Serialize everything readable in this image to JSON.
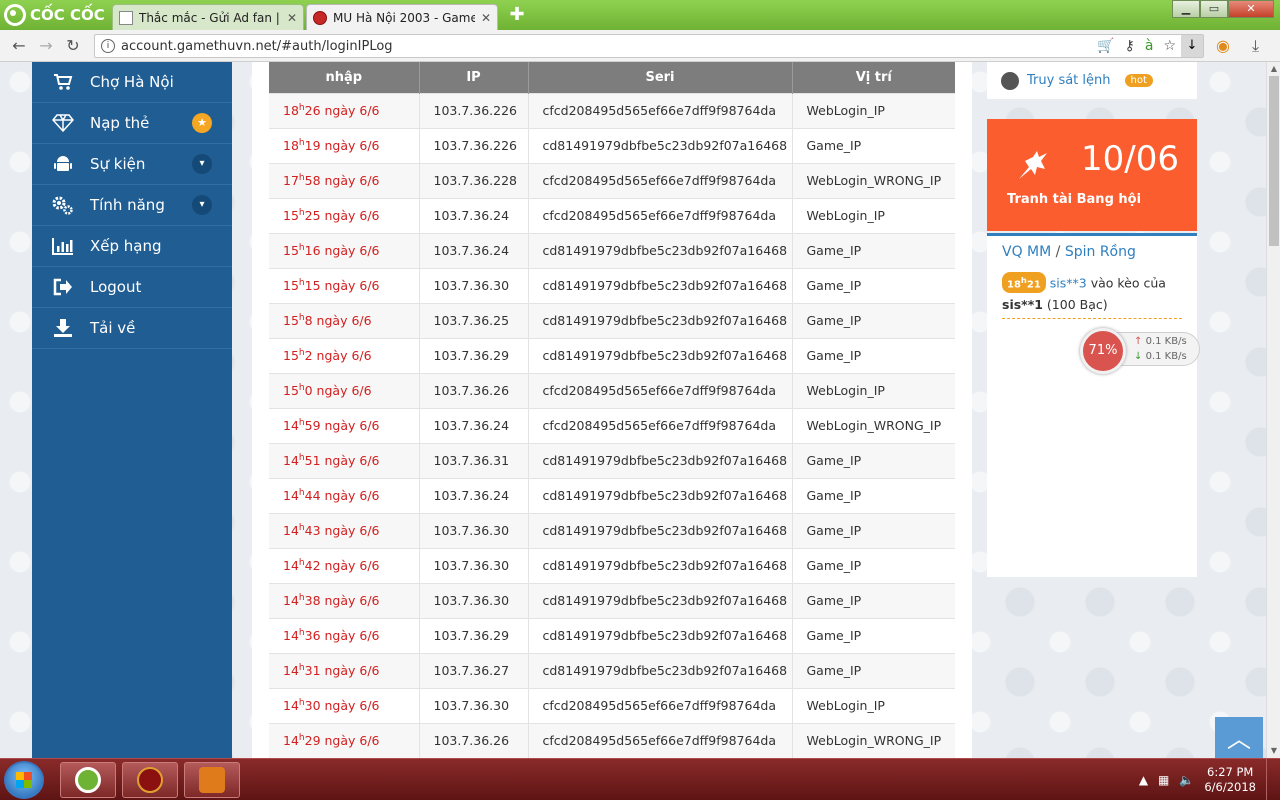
{
  "browser": {
    "brand": "CỐC CỐC",
    "tabs": [
      {
        "title": "Thắc mắc - Gửi Ad fan | Ga"
      },
      {
        "title": "MU Hà Nội 2003 - Gameth"
      }
    ],
    "url": "account.gamethuvn.net/#auth/loginIPLog"
  },
  "sidebar": {
    "items": [
      {
        "label": "Chợ Hà Nội",
        "icon": "cart-icon"
      },
      {
        "label": "Nạp thẻ",
        "icon": "diamond-icon",
        "badge": "★"
      },
      {
        "label": "Sự kiện",
        "icon": "android-icon",
        "badge": "▾"
      },
      {
        "label": "Tính năng",
        "icon": "gears-icon",
        "badge": "▾"
      },
      {
        "label": "Xếp hạng",
        "icon": "bar-chart-icon"
      },
      {
        "label": "Logout",
        "icon": "logout-icon"
      },
      {
        "label": "Tải về",
        "icon": "download-icon"
      }
    ]
  },
  "table": {
    "headers": [
      "nhập",
      "IP",
      "Seri",
      "Vị trí"
    ],
    "rows": [
      {
        "h": "18",
        "m": "26 ngày 6/6",
        "ip": "103.7.36.226",
        "seri": "cfcd208495d565ef66e7dff9f98764da",
        "loc": "WebLogin_IP"
      },
      {
        "h": "18",
        "m": "19 ngày 6/6",
        "ip": "103.7.36.226",
        "seri": "cd81491979dbfbe5c23db92f07a16468",
        "loc": "Game_IP"
      },
      {
        "h": "17",
        "m": "58 ngày 6/6",
        "ip": "103.7.36.228",
        "seri": "cfcd208495d565ef66e7dff9f98764da",
        "loc": "WebLogin_WRONG_IP"
      },
      {
        "h": "15",
        "m": "25 ngày 6/6",
        "ip": "103.7.36.24",
        "seri": "cfcd208495d565ef66e7dff9f98764da",
        "loc": "WebLogin_IP"
      },
      {
        "h": "15",
        "m": "16 ngày 6/6",
        "ip": "103.7.36.24",
        "seri": "cd81491979dbfbe5c23db92f07a16468",
        "loc": "Game_IP"
      },
      {
        "h": "15",
        "m": "15 ngày 6/6",
        "ip": "103.7.36.30",
        "seri": "cd81491979dbfbe5c23db92f07a16468",
        "loc": "Game_IP"
      },
      {
        "h": "15",
        "m": "8 ngày 6/6",
        "ip": "103.7.36.25",
        "seri": "cd81491979dbfbe5c23db92f07a16468",
        "loc": "Game_IP"
      },
      {
        "h": "15",
        "m": "2 ngày 6/6",
        "ip": "103.7.36.29",
        "seri": "cd81491979dbfbe5c23db92f07a16468",
        "loc": "Game_IP"
      },
      {
        "h": "15",
        "m": "0 ngày 6/6",
        "ip": "103.7.36.26",
        "seri": "cfcd208495d565ef66e7dff9f98764da",
        "loc": "WebLogin_IP"
      },
      {
        "h": "14",
        "m": "59 ngày 6/6",
        "ip": "103.7.36.24",
        "seri": "cfcd208495d565ef66e7dff9f98764da",
        "loc": "WebLogin_WRONG_IP"
      },
      {
        "h": "14",
        "m": "51 ngày 6/6",
        "ip": "103.7.36.31",
        "seri": "cd81491979dbfbe5c23db92f07a16468",
        "loc": "Game_IP"
      },
      {
        "h": "14",
        "m": "44 ngày 6/6",
        "ip": "103.7.36.24",
        "seri": "cd81491979dbfbe5c23db92f07a16468",
        "loc": "Game_IP"
      },
      {
        "h": "14",
        "m": "43 ngày 6/6",
        "ip": "103.7.36.30",
        "seri": "cd81491979dbfbe5c23db92f07a16468",
        "loc": "Game_IP"
      },
      {
        "h": "14",
        "m": "42 ngày 6/6",
        "ip": "103.7.36.30",
        "seri": "cd81491979dbfbe5c23db92f07a16468",
        "loc": "Game_IP"
      },
      {
        "h": "14",
        "m": "38 ngày 6/6",
        "ip": "103.7.36.30",
        "seri": "cd81491979dbfbe5c23db92f07a16468",
        "loc": "Game_IP"
      },
      {
        "h": "14",
        "m": "36 ngày 6/6",
        "ip": "103.7.36.29",
        "seri": "cd81491979dbfbe5c23db92f07a16468",
        "loc": "Game_IP"
      },
      {
        "h": "14",
        "m": "31 ngày 6/6",
        "ip": "103.7.36.27",
        "seri": "cd81491979dbfbe5c23db92f07a16468",
        "loc": "Game_IP"
      },
      {
        "h": "14",
        "m": "30 ngày 6/6",
        "ip": "103.7.36.30",
        "seri": "cfcd208495d565ef66e7dff9f98764da",
        "loc": "WebLogin_IP"
      },
      {
        "h": "14",
        "m": "29 ngày 6/6",
        "ip": "103.7.36.26",
        "seri": "cfcd208495d565ef66e7dff9f98764da",
        "loc": "WebLogin_WRONG_IP"
      }
    ]
  },
  "right": {
    "truysat_label": "Truy sát lệnh",
    "hot_label": "hot",
    "event_date": "10/06",
    "event_name": "Tranh tài Bang hội",
    "panel_title_a": "VQ MM",
    "panel_sep": " / ",
    "panel_title_b": "Spin Rồng",
    "feed_time_h": "18",
    "feed_time_m": "21",
    "feed_user": "sis**3",
    "feed_text": " vào kèo của ",
    "feed_target": "sis**1",
    "feed_amount": " (100 Bạc)"
  },
  "netmon": {
    "percent": "71%",
    "up": "0.1 KB/s",
    "down": "0.1 KB/s"
  },
  "taskbar": {
    "time": "6:27 PM",
    "date": "6/6/2018"
  },
  "colors": {
    "sidebar": "#1f5d93",
    "accent": "#fb5d2f",
    "link": "#2f7fbf",
    "time_red": "#d21f1f",
    "header_gray": "#7d7d7d"
  }
}
